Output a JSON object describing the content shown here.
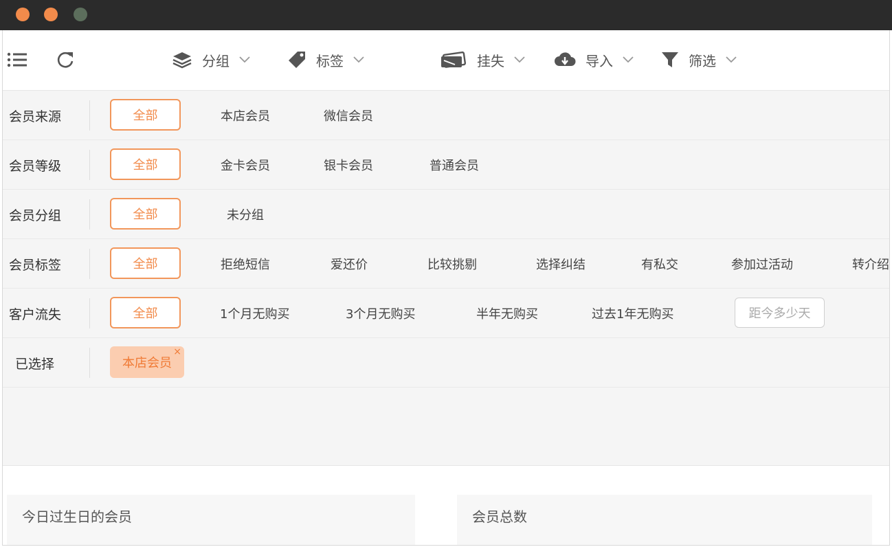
{
  "toolbar": {
    "icons": [
      "list-icon",
      "refresh-icon"
    ],
    "group_label": "分组",
    "tag_label": "标签",
    "lost_label": "挂失",
    "import_label": "导入",
    "filter_label": "筛选"
  },
  "filters": {
    "source": {
      "label": "会员来源",
      "all": "全部",
      "options": [
        "本店会员",
        "微信会员"
      ]
    },
    "level": {
      "label": "会员等级",
      "all": "全部",
      "options": [
        "金卡会员",
        "银卡会员",
        "普通会员"
      ]
    },
    "group": {
      "label": "会员分组",
      "all": "全部",
      "options": [
        "未分组"
      ]
    },
    "tags": {
      "label": "会员标签",
      "all": "全部",
      "options": [
        "拒绝短信",
        "爱还价",
        "比较挑剔",
        "选择纠结",
        "有私交",
        "参加过活动",
        "转介绍"
      ]
    },
    "churn": {
      "label": "客户流失",
      "all": "全部",
      "options": [
        "1个月无购买",
        "3个月无购买",
        "半年无购买",
        "过去1年无购买"
      ],
      "days_button": "距今多少天"
    },
    "selected": {
      "label": "已选择",
      "chip": "本店会员",
      "remove": "×"
    }
  },
  "panels": {
    "birthday_title": "今日过生日的会员",
    "total_title": "会员总数"
  },
  "colors": {
    "accent": "#f28b4b",
    "titlebar": "#2b2b2b",
    "selected_bg": "#fbcdb0"
  }
}
